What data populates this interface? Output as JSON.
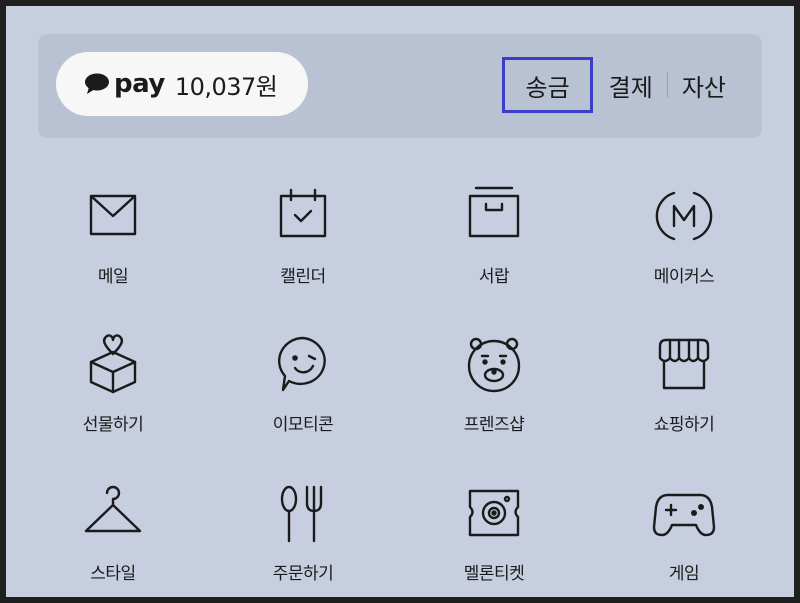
{
  "pay": {
    "brand": "pay",
    "amount": "10,037원",
    "actions": [
      {
        "label": "송금",
        "selected": true
      },
      {
        "label": "결제",
        "selected": false
      },
      {
        "label": "자산",
        "selected": false
      }
    ]
  },
  "services": [
    {
      "label": "메일",
      "icon": "mail-icon"
    },
    {
      "label": "캘린더",
      "icon": "calendar-icon"
    },
    {
      "label": "서랍",
      "icon": "drawer-icon"
    },
    {
      "label": "메이커스",
      "icon": "makers-icon"
    },
    {
      "label": "선물하기",
      "icon": "gift-icon"
    },
    {
      "label": "이모티콘",
      "icon": "emoticon-icon"
    },
    {
      "label": "프렌즈샵",
      "icon": "friends-shop-icon"
    },
    {
      "label": "쇼핑하기",
      "icon": "store-icon"
    },
    {
      "label": "스타일",
      "icon": "hanger-icon"
    },
    {
      "label": "주문하기",
      "icon": "fork-knife-icon"
    },
    {
      "label": "멜론티켓",
      "icon": "ticket-icon"
    },
    {
      "label": "게임",
      "icon": "gamepad-icon"
    }
  ],
  "colors": {
    "background": "#c6cedf",
    "pay_bar": "#b9c2d2",
    "highlight": "#3b3fc8"
  }
}
